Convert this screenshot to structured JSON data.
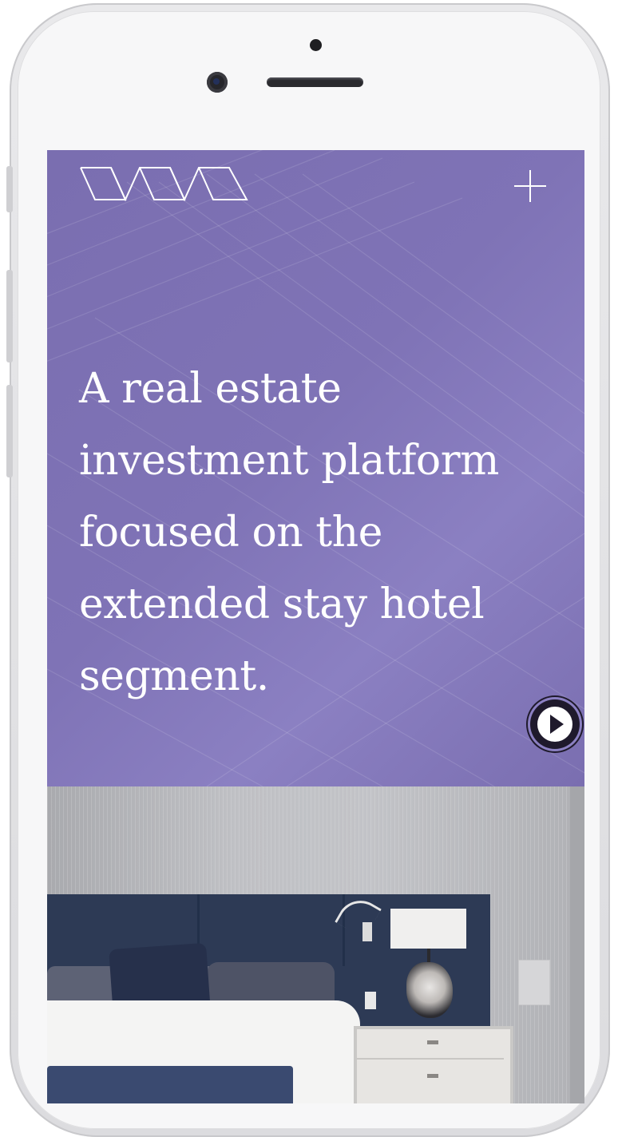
{
  "device": {
    "model": "smartphone-mockup",
    "frame_color": "#e4e4e6"
  },
  "header": {
    "logo_icon": "wave-logo-icon",
    "menu_icon": "plus-icon"
  },
  "hero": {
    "headline": "A real estate investment platform focused on the extended stay hotel segment.",
    "background_color": "#7a6fb0",
    "play_icon": "play-circle-icon"
  },
  "photo": {
    "subject": "hotel-bedroom-image"
  },
  "colors": {
    "hero_purple": "#7a6fb0",
    "text_white": "#ffffff",
    "play_dark": "#1f1a2c"
  }
}
